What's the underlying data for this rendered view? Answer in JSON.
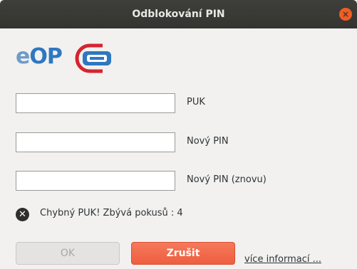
{
  "window": {
    "title": "Odblokování PIN",
    "close_symbol": "×"
  },
  "logo": {
    "text_e": "e",
    "text_op": "OP",
    "emblem": "eop-chip-emblem-icon",
    "colors": {
      "light_blue": "#6f9bc8",
      "blue": "#2f77c0",
      "red": "#d6242f"
    }
  },
  "form": {
    "puk": {
      "label": "PUK",
      "value": ""
    },
    "new_pin": {
      "label": "Nový PIN",
      "value": ""
    },
    "new_pin_again": {
      "label": "Nový PIN (znovu)",
      "value": ""
    }
  },
  "status": {
    "icon": "error-x-icon",
    "message": "Chybný PUK! Zbývá pokusů : 4"
  },
  "buttons": {
    "ok": "OK",
    "cancel": "Zrušit",
    "more_info": "více informací ..."
  },
  "colors": {
    "titlebar": "#3a3a37",
    "close": "#f15d22",
    "cancel_button": "#f06a4c",
    "background": "#f2f1f0"
  }
}
